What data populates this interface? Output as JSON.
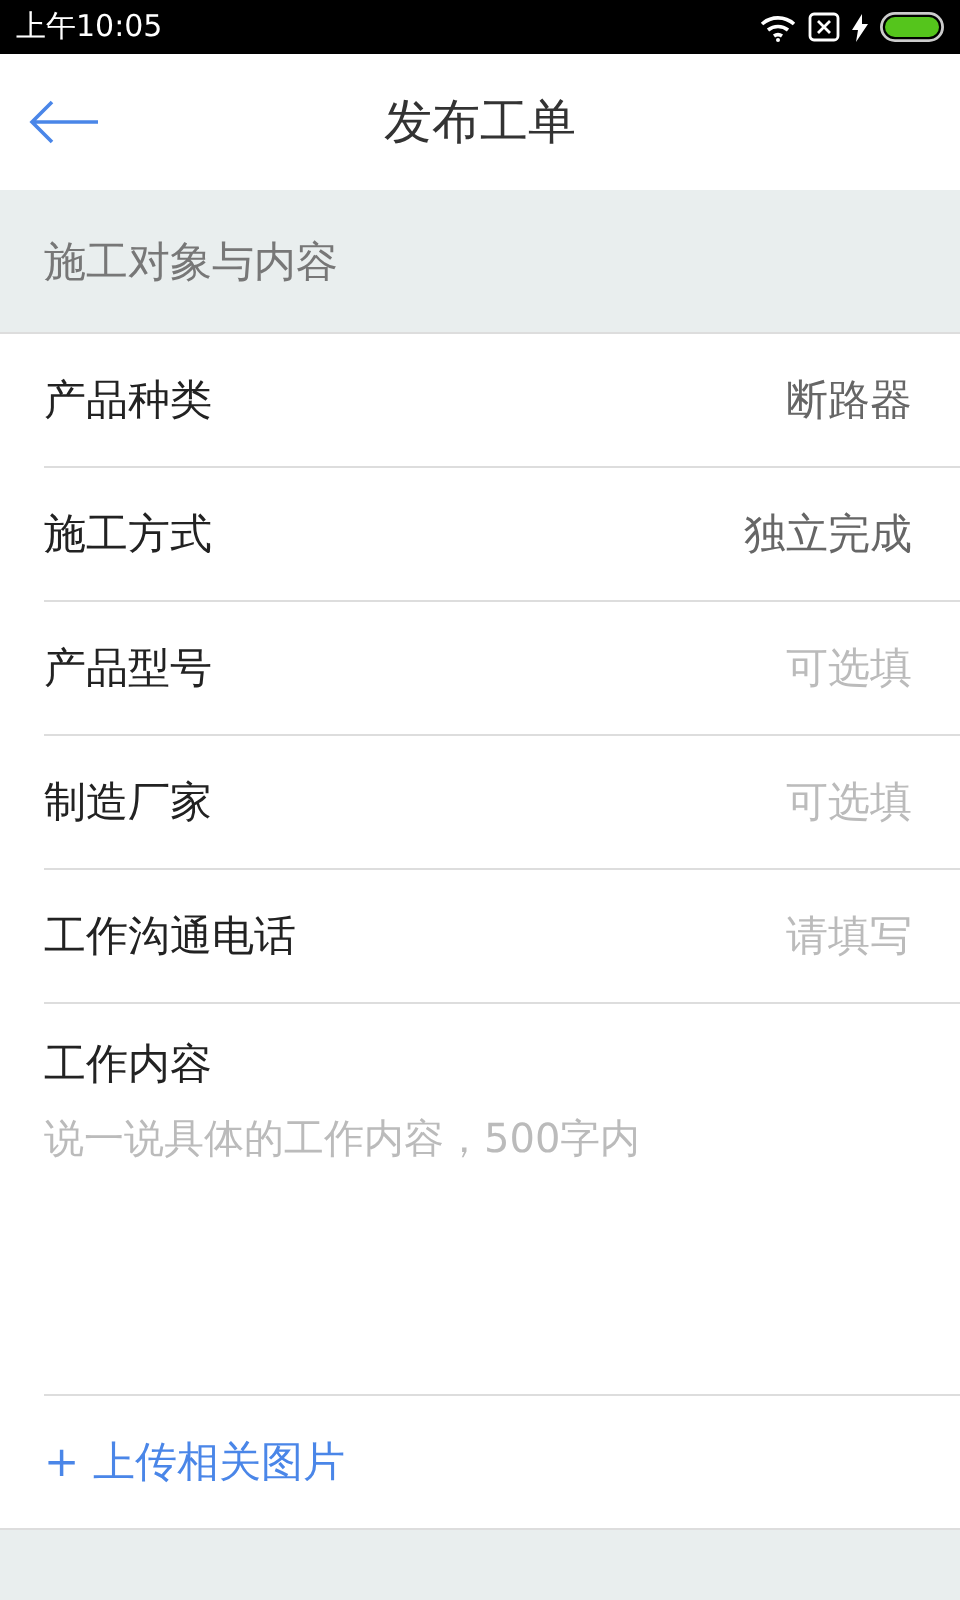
{
  "status_bar": {
    "time": "上午10:05"
  },
  "header": {
    "title": "发布工单"
  },
  "section": {
    "title": "施工对象与内容"
  },
  "fields": [
    {
      "label": "产品种类",
      "value": "断路器"
    },
    {
      "label": "施工方式",
      "value": "独立完成"
    },
    {
      "label": "产品型号",
      "placeholder": "可选填"
    },
    {
      "label": "制造厂家",
      "placeholder": "可选填"
    },
    {
      "label": "工作沟通电话",
      "placeholder": "请填写"
    }
  ],
  "content": {
    "label": "工作内容",
    "placeholder": "说一说具体的工作内容，500字内"
  },
  "upload": {
    "label": "+ 上传相关图片"
  }
}
